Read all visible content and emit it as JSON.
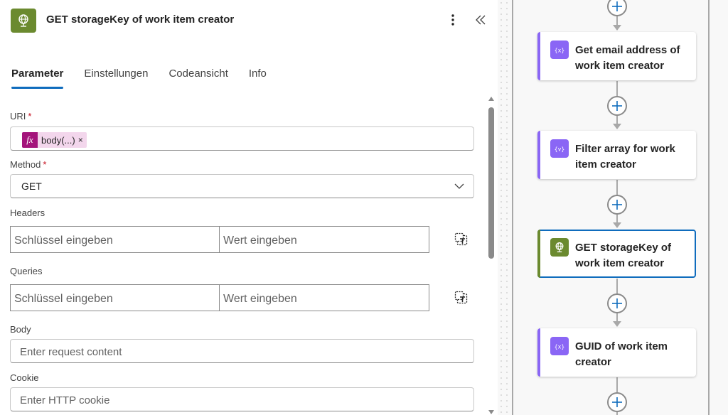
{
  "colors": {
    "accent": "#0f6cbd",
    "action_green": "#6b8a2f",
    "compose_purple": "#8a66f5",
    "expression_magenta": "#a4147b",
    "token_bg": "#f3d6ec",
    "required": "#c50f1f"
  },
  "header": {
    "title": "GET storageKey of work item creator",
    "icon": "globe-icon",
    "more_icon": "more-vertical-icon",
    "collapse_icon": "double-chevron-left-icon"
  },
  "tabs": [
    {
      "label": "Parameter",
      "active": true
    },
    {
      "label": "Einstellungen",
      "active": false
    },
    {
      "label": "Codeansicht",
      "active": false
    },
    {
      "label": "Info",
      "active": false
    }
  ],
  "form": {
    "uri": {
      "label": "URI",
      "required_mark": "*",
      "token_fx": "fx",
      "token_text": "body(...)",
      "token_remove": "×"
    },
    "method": {
      "label": "Method",
      "required_mark": "*",
      "value": "GET"
    },
    "headers": {
      "label": "Headers",
      "key_placeholder": "Schlüssel eingeben",
      "value_placeholder": "Wert eingeben"
    },
    "queries": {
      "label": "Queries",
      "key_placeholder": "Schlüssel eingeben",
      "value_placeholder": "Wert eingeben"
    },
    "body": {
      "label": "Body",
      "placeholder": "Enter request content"
    },
    "cookie": {
      "label": "Cookie",
      "placeholder": "Enter HTTP cookie"
    }
  },
  "flow": {
    "steps": [
      {
        "title": "Get email address of work item creator",
        "icon": "compose-icon",
        "color": "#8a66f5",
        "selected": false
      },
      {
        "title": "Filter array for work item creator",
        "icon": "compose-icon",
        "color": "#8a66f5",
        "selected": false
      },
      {
        "title": "GET storageKey of work item creator",
        "icon": "globe-icon",
        "color": "#6b8a2f",
        "selected": true
      },
      {
        "title": "GUID of work item creator",
        "icon": "compose-icon",
        "color": "#8a66f5",
        "selected": false
      }
    ]
  }
}
